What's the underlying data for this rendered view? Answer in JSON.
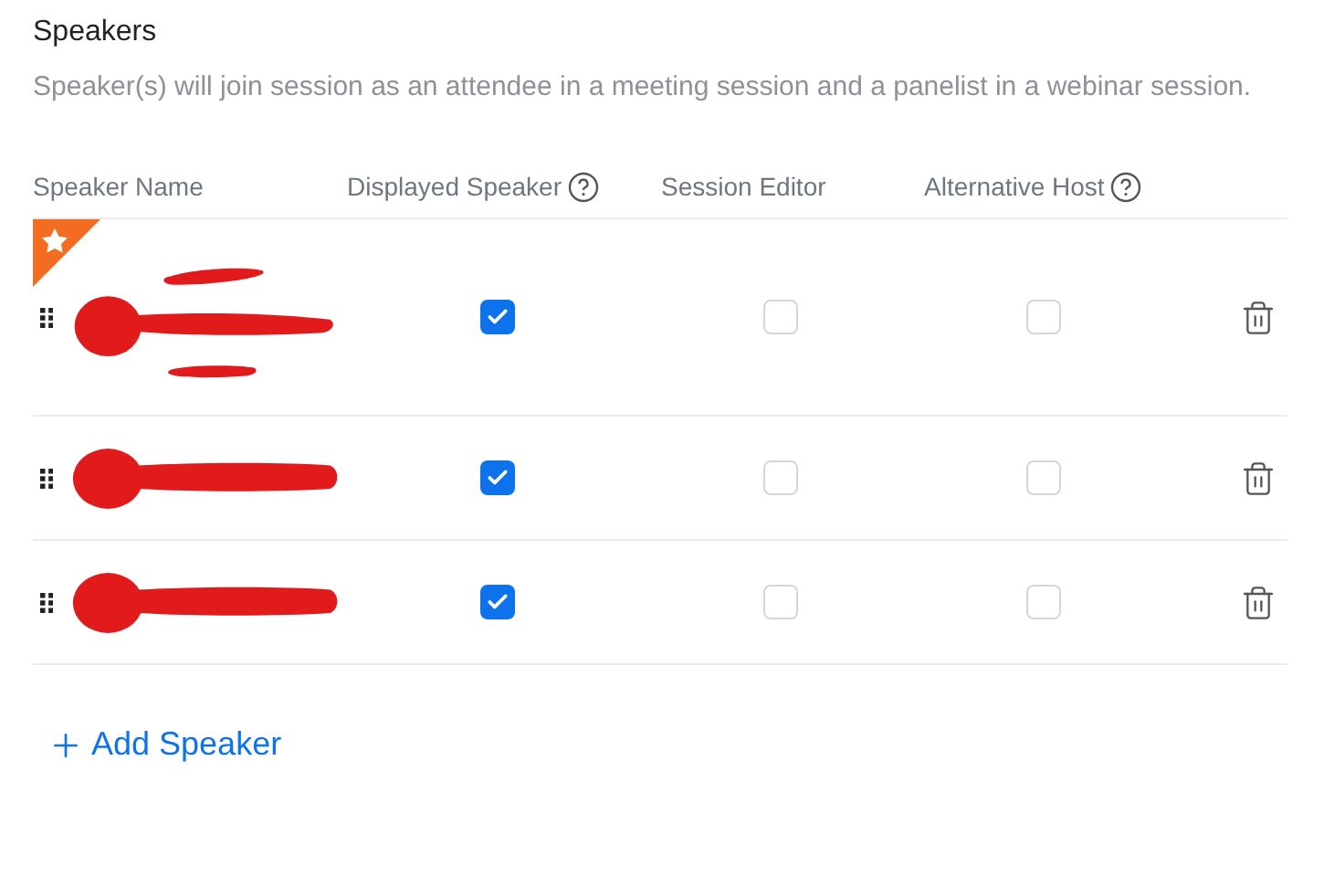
{
  "title": "Speakers",
  "description": "Speaker(s) will join session as an attendee in a meeting session and a panelist in a webinar session.",
  "columns": [
    {
      "label": "Speaker Name",
      "help": false
    },
    {
      "label": "Displayed Speaker",
      "help": true
    },
    {
      "label": "Session Editor",
      "help": false
    },
    {
      "label": "Alternative Host",
      "help": true
    }
  ],
  "rows": [
    {
      "featured": true,
      "tall": true,
      "displayed_speaker": true,
      "session_editor": false,
      "alternative_host": false
    },
    {
      "featured": false,
      "tall": false,
      "displayed_speaker": true,
      "session_editor": false,
      "alternative_host": false
    },
    {
      "featured": false,
      "tall": false,
      "displayed_speaker": true,
      "session_editor": false,
      "alternative_host": false
    }
  ],
  "add_button": {
    "label": "Add Speaker"
  }
}
